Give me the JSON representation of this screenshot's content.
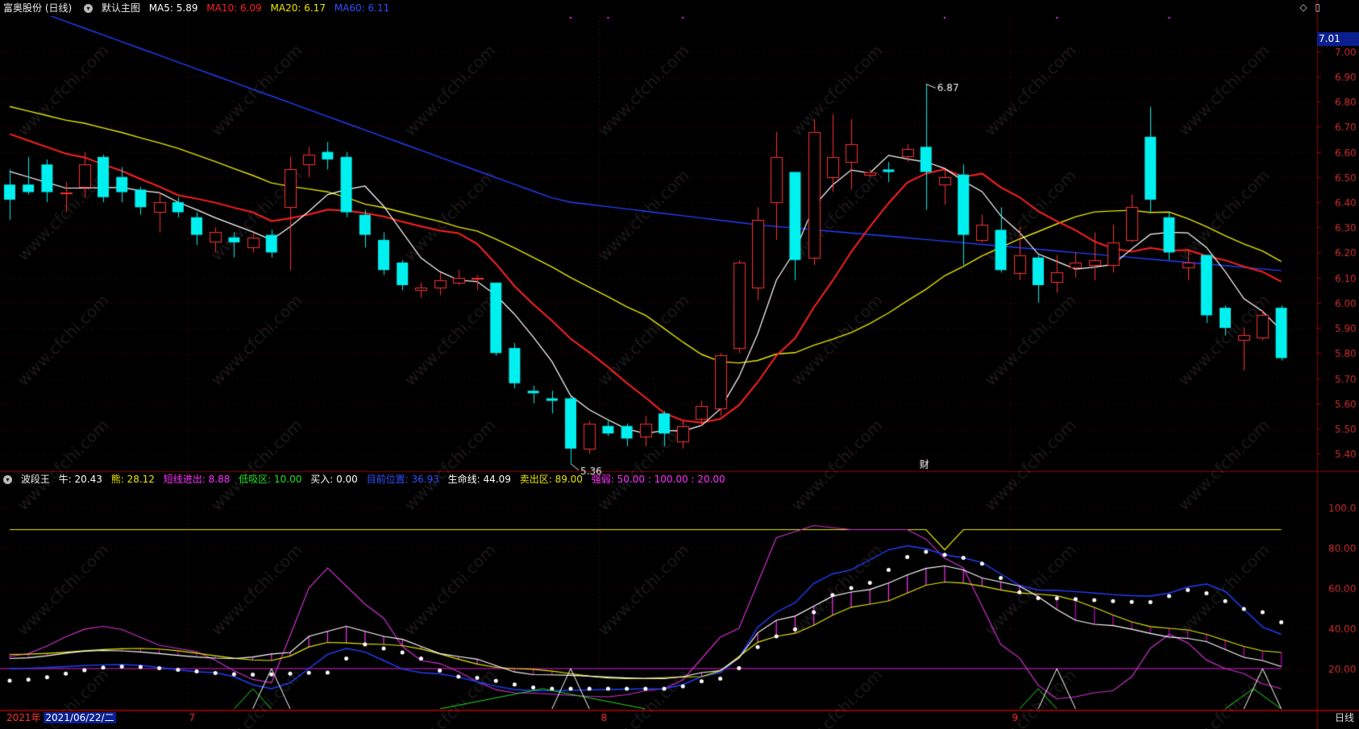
{
  "main_header": {
    "stock_title": "富奥股份 (日线)",
    "chart_label": "默认主图",
    "ma5": {
      "label": "MA5: 5.89",
      "color": "#ffffff"
    },
    "ma10": {
      "label": "MA10: 6.09",
      "color": "#ff2020"
    },
    "ma20": {
      "label": "MA20: 6.17",
      "color": "#e8e800"
    },
    "ma60": {
      "label": "MA60: 6.11",
      "color": "#2040ff"
    }
  },
  "indicator_header": {
    "name": "波段王",
    "items": [
      {
        "label": "牛: 20.43",
        "color": "#ffffff"
      },
      {
        "label": "熊: 28.12",
        "color": "#e8e800"
      },
      {
        "label": "短线进出: 8.88",
        "color": "#ff30ff"
      },
      {
        "label": "低吸区: 10.00",
        "color": "#20e020"
      },
      {
        "label": "买入: 0.00",
        "color": "#ffffff"
      },
      {
        "label": "目前位置: 36.93",
        "color": "#2040ff"
      },
      {
        "label": "生命线: 44.09",
        "color": "#ffffff"
      },
      {
        "label": "卖出区: 89.00",
        "color": "#e8e800"
      },
      {
        "label": "强弱: 50.00 : 100.00 : 20.00",
        "color": "#ff30ff"
      }
    ]
  },
  "price_axis": {
    "ticks": [
      "7.00",
      "6.90",
      "6.80",
      "6.70",
      "6.60",
      "6.50",
      "6.40",
      "6.30",
      "6.20",
      "6.10",
      "6.00",
      "5.90",
      "5.80",
      "5.70",
      "5.60",
      "5.50",
      "5.40"
    ],
    "current_price": "7.01"
  },
  "indicator_axis": {
    "ticks": [
      "100.0",
      "80.00",
      "60.00",
      "40.00",
      "20.00"
    ]
  },
  "annotations": {
    "high": "6.87",
    "low": "5.36",
    "finance_marker": "财"
  },
  "date_bar": {
    "year": "2021年",
    "date": "2021/06/22/二",
    "months": [
      "7",
      "8",
      "9"
    ],
    "period_button": "日线"
  },
  "watermark": "www.cfchi.com",
  "colors": {
    "up": "#ff3030",
    "down": "#00f0f0",
    "grid": "#8a0000"
  },
  "chart_data": {
    "type": "candlestick",
    "candles": [
      [
        6.47,
        6.41,
        6.53,
        6.33
      ],
      [
        6.47,
        6.44,
        6.58,
        6.43
      ],
      [
        6.55,
        6.44,
        6.57,
        6.4
      ],
      [
        6.44,
        6.44,
        6.48,
        6.36
      ],
      [
        6.46,
        6.55,
        6.6,
        6.42
      ],
      [
        6.58,
        6.42,
        6.59,
        6.4
      ],
      [
        6.5,
        6.44,
        6.54,
        6.4
      ],
      [
        6.45,
        6.38,
        6.46,
        6.35
      ],
      [
        6.36,
        6.4,
        6.44,
        6.28
      ],
      [
        6.4,
        6.36,
        6.42,
        6.34
      ],
      [
        6.34,
        6.27,
        6.36,
        6.23
      ],
      [
        6.24,
        6.28,
        6.3,
        6.2
      ],
      [
        6.26,
        6.24,
        6.28,
        6.18
      ],
      [
        6.22,
        6.26,
        6.28,
        6.2
      ],
      [
        6.27,
        6.2,
        6.29,
        6.18
      ],
      [
        6.38,
        6.53,
        6.58,
        6.13
      ],
      [
        6.55,
        6.59,
        6.62,
        6.5
      ],
      [
        6.6,
        6.57,
        6.64,
        6.53
      ],
      [
        6.58,
        6.36,
        6.6,
        6.34
      ],
      [
        6.35,
        6.27,
        6.37,
        6.22
      ],
      [
        6.25,
        6.13,
        6.28,
        6.11
      ],
      [
        6.16,
        6.07,
        6.17,
        6.05
      ],
      [
        6.05,
        6.06,
        6.08,
        6.02
      ],
      [
        6.06,
        6.09,
        6.12,
        6.03
      ],
      [
        6.08,
        6.1,
        6.13,
        6.07
      ],
      [
        6.1,
        6.1,
        6.11,
        6.05
      ],
      [
        6.08,
        5.8,
        6.08,
        5.79
      ],
      [
        5.82,
        5.68,
        5.84,
        5.66
      ],
      [
        5.65,
        5.64,
        5.67,
        5.6
      ],
      [
        5.62,
        5.61,
        5.65,
        5.56
      ],
      [
        5.62,
        5.42,
        5.63,
        5.36
      ],
      [
        5.42,
        5.52,
        5.53,
        5.4
      ],
      [
        5.51,
        5.48,
        5.53,
        5.47
      ],
      [
        5.51,
        5.46,
        5.52,
        5.43
      ],
      [
        5.47,
        5.52,
        5.55,
        5.43
      ],
      [
        5.56,
        5.48,
        5.57,
        5.43
      ],
      [
        5.45,
        5.51,
        5.53,
        5.42
      ],
      [
        5.54,
        5.59,
        5.61,
        5.51
      ],
      [
        5.58,
        5.79,
        5.8,
        5.55
      ],
      [
        5.82,
        6.16,
        6.17,
        5.8
      ],
      [
        6.06,
        6.33,
        6.38,
        6.01
      ],
      [
        6.4,
        6.58,
        6.68,
        6.25
      ],
      [
        6.52,
        6.17,
        6.52,
        6.09
      ],
      [
        6.18,
        6.68,
        6.73,
        6.15
      ],
      [
        6.5,
        6.58,
        6.75,
        6.44
      ],
      [
        6.56,
        6.63,
        6.73,
        6.45
      ],
      [
        6.51,
        6.52,
        6.53,
        6.5
      ],
      [
        6.53,
        6.52,
        6.56,
        6.48
      ],
      [
        6.58,
        6.61,
        6.63,
        6.56
      ],
      [
        6.62,
        6.52,
        6.87,
        6.37
      ],
      [
        6.47,
        6.5,
        6.53,
        6.39
      ],
      [
        6.51,
        6.27,
        6.55,
        6.15
      ],
      [
        6.25,
        6.31,
        6.35,
        6.24
      ],
      [
        6.29,
        6.13,
        6.38,
        6.12
      ],
      [
        6.12,
        6.19,
        6.3,
        6.09
      ],
      [
        6.18,
        6.07,
        6.19,
        6.0
      ],
      [
        6.08,
        6.12,
        6.19,
        6.04
      ],
      [
        6.14,
        6.16,
        6.2,
        6.1
      ],
      [
        6.15,
        6.17,
        6.28,
        6.09
      ],
      [
        6.15,
        6.24,
        6.31,
        6.12
      ],
      [
        6.25,
        6.38,
        6.43,
        6.24
      ],
      [
        6.66,
        6.41,
        6.78,
        6.36
      ],
      [
        6.34,
        6.2,
        6.36,
        6.17
      ],
      [
        6.14,
        6.16,
        6.21,
        6.09
      ],
      [
        6.19,
        5.95,
        6.19,
        5.92
      ],
      [
        5.98,
        5.9,
        5.99,
        5.87
      ],
      [
        5.85,
        5.87,
        5.9,
        5.73
      ],
      [
        5.86,
        5.95,
        5.97,
        5.85
      ],
      [
        5.98,
        5.78,
        5.99,
        5.77
      ]
    ],
    "ylim": [
      5.33,
      7.14
    ],
    "indicator_ylim": [
      0,
      110
    ]
  }
}
